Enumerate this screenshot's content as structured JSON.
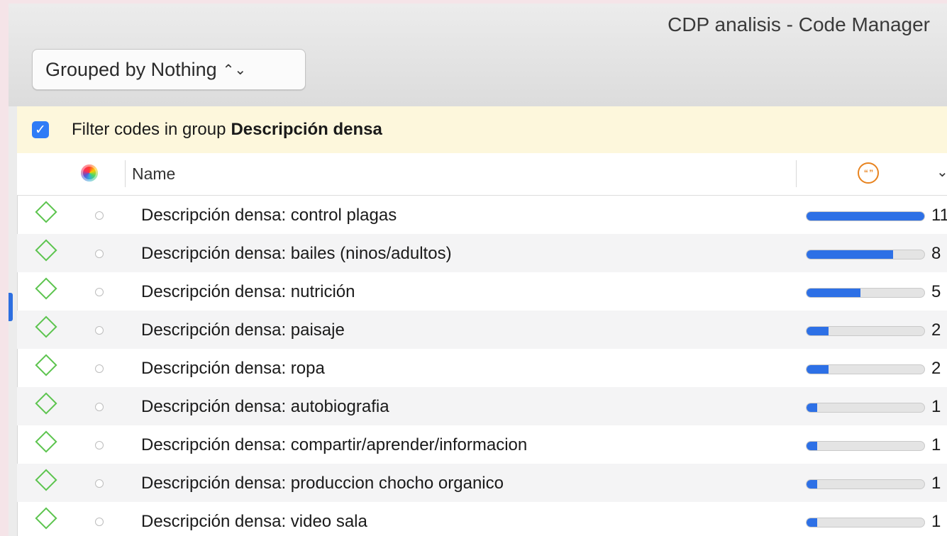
{
  "window": {
    "title": "CDP analisis - Code Manager"
  },
  "toolbar": {
    "group_by_label": "Grouped by Nothing"
  },
  "filter": {
    "checked": true,
    "prefix": "Filter codes in group",
    "group_name": "Descripción densa"
  },
  "table": {
    "headers": {
      "name": "Name"
    },
    "max_count": 11,
    "rows": [
      {
        "name": "Descripción densa: control plagas",
        "count": "11"
      },
      {
        "name": "Descripción densa: bailes (ninos/adultos)",
        "count": "8"
      },
      {
        "name": "Descripción densa: nutrición",
        "count": "5"
      },
      {
        "name": "Descripción densa: paisaje",
        "count": "2"
      },
      {
        "name": "Descripción densa: ropa",
        "count": "2"
      },
      {
        "name": "Descripción densa: autobiografia",
        "count": "1"
      },
      {
        "name": "Descripción densa: compartir/aprender/informacion",
        "count": "1"
      },
      {
        "name": "Descripción densa: produccion chocho organico",
        "count": "1"
      },
      {
        "name": "Descripción densa: video sala",
        "count": "1"
      }
    ]
  },
  "colors": {
    "accent": "#2d70e6",
    "code_icon": "#5cc44e",
    "quotation_icon": "#e8831f",
    "filter_bg": "#fdf7dc"
  }
}
